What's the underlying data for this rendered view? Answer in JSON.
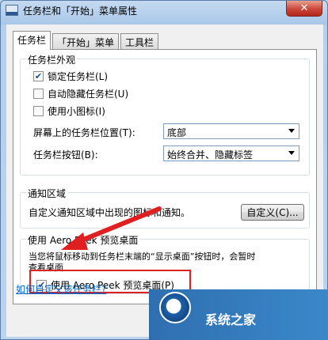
{
  "window": {
    "title": "任务栏和「开始」菜单属性",
    "close_label": "✕"
  },
  "tabs": [
    {
      "label": "任务栏"
    },
    {
      "label": "「开始」菜单"
    },
    {
      "label": "工具栏"
    }
  ],
  "appearance": {
    "title": "任务栏外观",
    "checkboxes": [
      {
        "label": "锁定任务栏(L)",
        "checked": true
      },
      {
        "label": "自动隐藏任务栏(U)",
        "checked": false
      },
      {
        "label": "使用小图标(I)",
        "checked": false
      }
    ],
    "location_label": "屏幕上的任务栏位置(T):",
    "location_value": "底部",
    "buttons_label": "任务栏按钮(B):",
    "buttons_value": "始终合并、隐藏标签"
  },
  "notification": {
    "title": "通知区域",
    "desc": "自定义通知区域中出现的图标和通知。",
    "customize_label": "自定义(C)..."
  },
  "aero": {
    "title": "使用 Aero Peek 预览桌面",
    "desc_line1": "当您将鼠标移动到任务栏末端的“显示桌面”按钮时，会暂时",
    "desc_line2": "查看桌面",
    "checkbox_label": "使用 Aero Peek 预览桌面(P)",
    "checked": true
  },
  "help_link": "如何自定义该任务栏?",
  "watermark_text": "系统之家",
  "colors": {
    "highlight_box": "#e02020",
    "arrow": "#e02020",
    "link": "#0066cc"
  }
}
